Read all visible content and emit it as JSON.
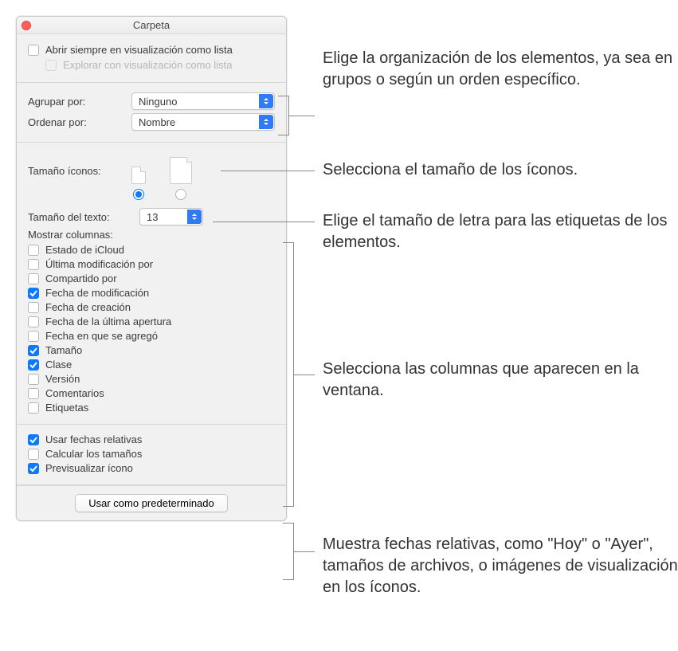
{
  "window": {
    "title": "Carpeta"
  },
  "top": {
    "always_list": "Abrir siempre en visualización como lista",
    "browse_list": "Explorar con visualización como lista"
  },
  "grouping": {
    "group_by_label": "Agrupar por:",
    "group_by_value": "Ninguno",
    "sort_by_label": "Ordenar por:",
    "sort_by_value": "Nombre"
  },
  "icon_size": {
    "label": "Tamaño íconos:"
  },
  "text_size": {
    "label": "Tamaño del texto:",
    "value": "13"
  },
  "columns": {
    "header": "Mostrar columnas:",
    "items": [
      {
        "label": "Estado de iCloud",
        "checked": false
      },
      {
        "label": "Última modificación por",
        "checked": false
      },
      {
        "label": "Compartido por",
        "checked": false
      },
      {
        "label": "Fecha de modificación",
        "checked": true
      },
      {
        "label": "Fecha de creación",
        "checked": false
      },
      {
        "label": "Fecha de la última apertura",
        "checked": false
      },
      {
        "label": "Fecha en que se agregó",
        "checked": false
      },
      {
        "label": "Tamaño",
        "checked": true
      },
      {
        "label": "Clase",
        "checked": true
      },
      {
        "label": "Versión",
        "checked": false
      },
      {
        "label": "Comentarios",
        "checked": false
      },
      {
        "label": "Etiquetas",
        "checked": false
      }
    ]
  },
  "bottom": {
    "items": [
      {
        "label": "Usar fechas relativas",
        "checked": true
      },
      {
        "label": "Calcular los tamaños",
        "checked": false
      },
      {
        "label": "Previsualizar ícono",
        "checked": true
      }
    ]
  },
  "footer": {
    "button": "Usar como predeterminado"
  },
  "callouts": {
    "c1": "Elige la organización de los elementos, ya sea en grupos o según un orden específico.",
    "c2": "Selecciona el tamaño de los íconos.",
    "c3": "Elige el tamaño de letra para las etiquetas de los elementos.",
    "c4": "Selecciona las columnas que aparecen en la ventana.",
    "c5": "Muestra fechas relativas, como \"Hoy\" o \"Ayer\", tamaños de archivos, o imágenes de visualización en los íconos."
  }
}
